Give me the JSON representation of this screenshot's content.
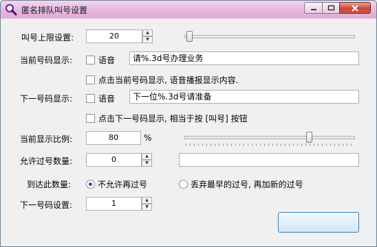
{
  "window": {
    "title": "匿名排队叫号设置"
  },
  "caption_buttons": {
    "minimize": "minimize-icon",
    "maximize": "maximize-icon",
    "close": "close-icon"
  },
  "fields": {
    "call_limit": {
      "label": "叫号上限设置:",
      "value": "20",
      "slider_level": 0.04
    },
    "current_number": {
      "label": "当前号码显示:",
      "voice_label": "语音",
      "voice_checked": false,
      "text": "请%.3d号办理业务",
      "click_option": "点击当前号码显示, 语音播报显示内容.",
      "click_checked": false
    },
    "next_number": {
      "label": "下一号码显示:",
      "voice_label": "语音",
      "voice_checked": false,
      "text": "下一位%.3d号请准备",
      "click_option": "点击下一号码显示, 相当于按 [叫号] 按钮",
      "click_checked": false
    },
    "display_ratio": {
      "label": "当前显示比例:",
      "value": "80",
      "unit": "%",
      "slider_level": 0.75
    },
    "allowed_skips": {
      "label": "允许过号数量:",
      "value": "0",
      "text": ""
    },
    "on_reach": {
      "label": "到达此数量:",
      "options": [
        "不允许再过号",
        "丢弃最早的过号, 再加新的过号"
      ],
      "selected": 0
    },
    "next_setting": {
      "label": "下一号码设置:",
      "value": "1"
    }
  },
  "confirm_button": {
    "label": ""
  }
}
